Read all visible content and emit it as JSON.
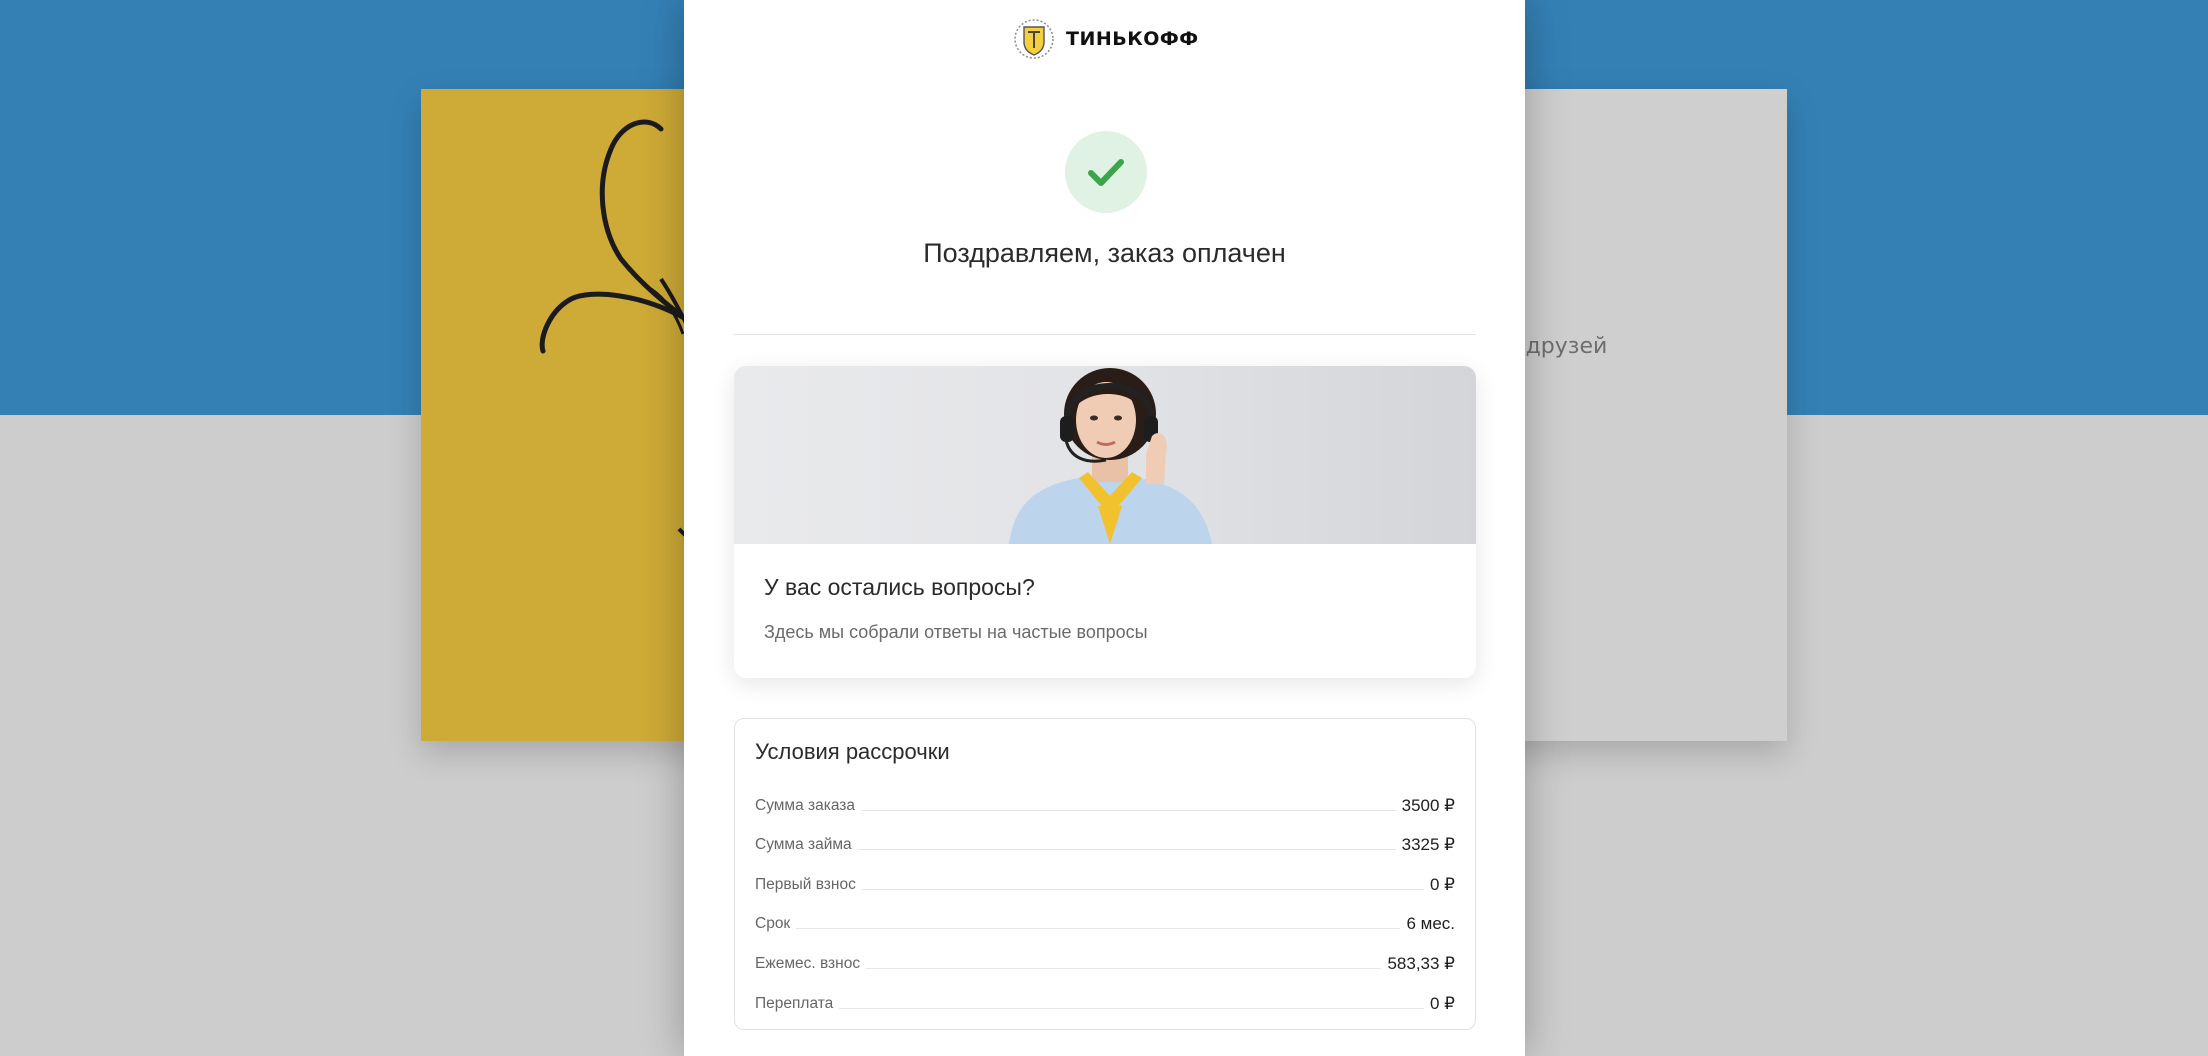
{
  "background": {
    "partial_text": "ии друзей",
    "colors": {
      "top": "#3480b5",
      "card": "#cfcfcf",
      "yellow": "#ceaa36"
    }
  },
  "logo": {
    "text": "ТИНЬКОФФ",
    "icon": "tinkoff-crest-icon"
  },
  "status": {
    "icon": "check-icon",
    "title": "Поздравляем, заказ оплачен",
    "accent": "#3aa54a"
  },
  "faq": {
    "title": "У вас остались вопросы?",
    "subtitle": "Здесь мы собрали ответы на частые вопросы",
    "image": "support-operator-photo"
  },
  "terms": {
    "title": "Условия рассрочки",
    "rows": [
      {
        "label": "Сумма заказа",
        "value": "3500 ₽"
      },
      {
        "label": "Сумма займа",
        "value": "3325 ₽"
      },
      {
        "label": "Первый взнос",
        "value": "0 ₽"
      },
      {
        "label": "Срок",
        "value": "6 мес."
      },
      {
        "label": "Ежемес. взнос",
        "value": "583,33 ₽"
      },
      {
        "label": "Переплата",
        "value": "0 ₽"
      }
    ]
  }
}
